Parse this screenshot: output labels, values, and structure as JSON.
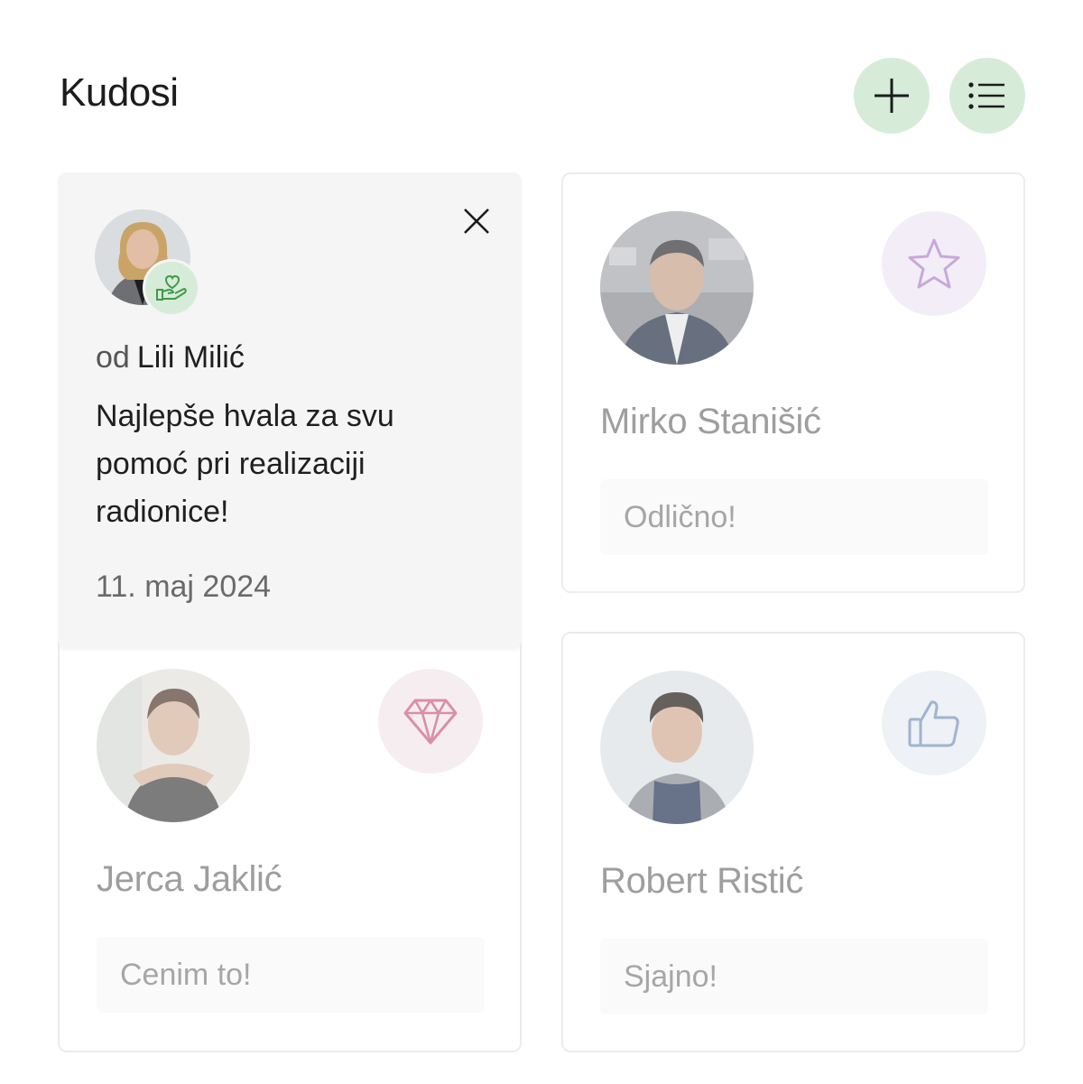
{
  "header": {
    "title": "Kudosi",
    "add_button_icon": "plus-icon",
    "list_button_icon": "list-icon"
  },
  "popup": {
    "from_prefix": "od",
    "from_name": "Lili Milić",
    "message": "Najlepše hvala za svu pomoć pri realizaciji radionice!",
    "date": "11. maj 2024",
    "kudo_icon": "helping-hand-heart-icon",
    "close_icon": "close-icon"
  },
  "cards": [
    {
      "name": "Mirko Stanišić",
      "note": "Odlično!",
      "icon": "star-icon",
      "icon_color": "#c8a8dc"
    },
    {
      "name": "Jerca Jaklić",
      "note": "Cenim to!",
      "icon": "diamond-icon",
      "icon_color": "#d98fa8"
    },
    {
      "name": "Robert Ristić",
      "note": "Sjajno!",
      "icon": "thumbs-up-icon",
      "icon_color": "#9fb4d0"
    }
  ],
  "colors": {
    "accent_green": "#d6ecd8",
    "kudo_icon_green": "#3e9a4a"
  }
}
